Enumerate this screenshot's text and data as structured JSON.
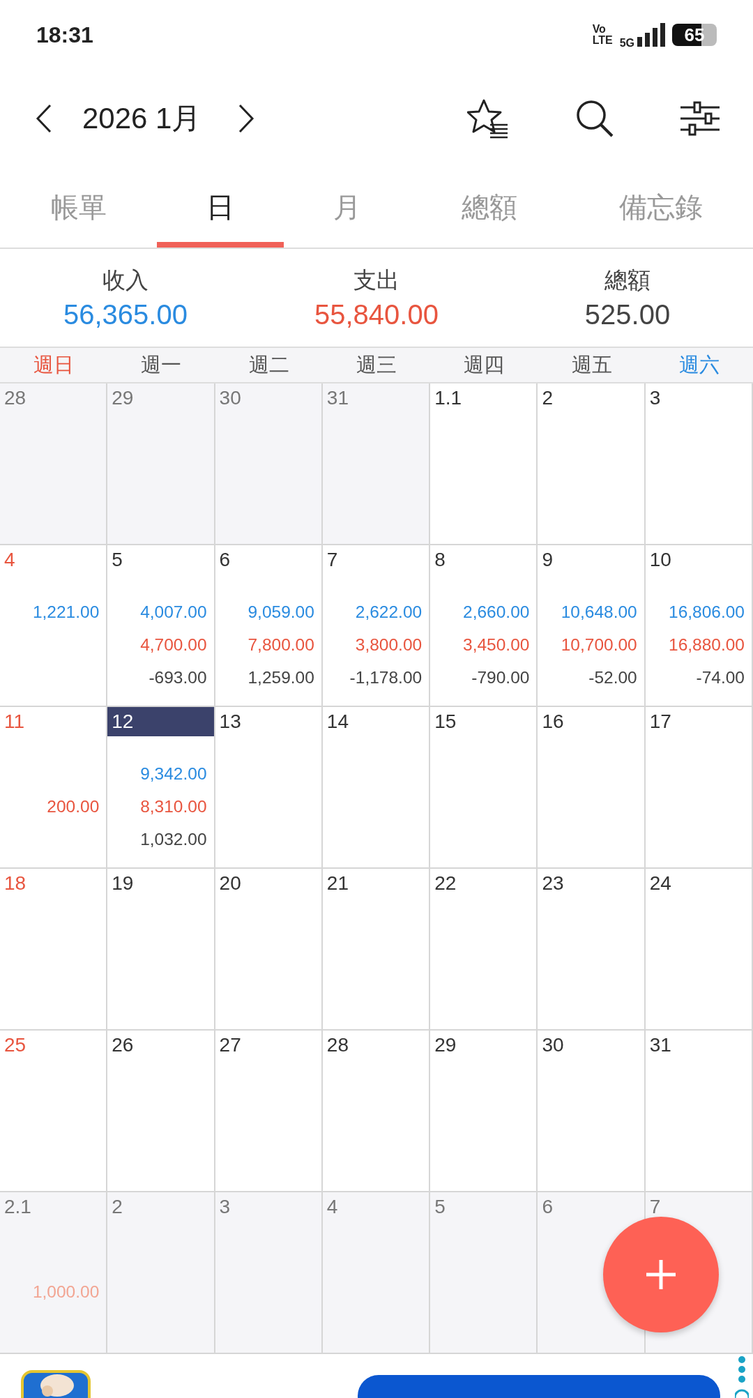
{
  "status_bar": {
    "time": "18:31",
    "network_top": "Vo",
    "network_bottom": "LTE",
    "signal_label": "5G",
    "battery": "65"
  },
  "header": {
    "title": "2026 1月"
  },
  "tabs": [
    {
      "label": "帳單",
      "selected": false
    },
    {
      "label": "日",
      "selected": true
    },
    {
      "label": "月",
      "selected": false
    },
    {
      "label": "總額",
      "selected": false
    },
    {
      "label": "備忘錄",
      "selected": false
    }
  ],
  "summary": [
    {
      "label": "收入",
      "value": "56,365.00",
      "kind": "income"
    },
    {
      "label": "支出",
      "value": "55,840.00",
      "kind": "expense"
    },
    {
      "label": "總額",
      "value": "525.00",
      "kind": "total"
    }
  ],
  "weekdays": [
    {
      "label": "週日",
      "color": "#e8553f"
    },
    {
      "label": "週一",
      "color": "#555555"
    },
    {
      "label": "週二",
      "color": "#555555"
    },
    {
      "label": "週三",
      "color": "#555555"
    },
    {
      "label": "週四",
      "color": "#555555"
    },
    {
      "label": "週五",
      "color": "#555555"
    },
    {
      "label": "週六",
      "color": "#2a8be0"
    }
  ],
  "weeks": [
    [
      {
        "day": "28",
        "other_month": true,
        "selected": false
      },
      {
        "day": "29",
        "other_month": true,
        "selected": false
      },
      {
        "day": "30",
        "other_month": true,
        "selected": false
      },
      {
        "day": "31",
        "other_month": true,
        "selected": false
      },
      {
        "day": "1.1",
        "other_month": false,
        "selected": false
      },
      {
        "day": "2",
        "other_month": false,
        "selected": false
      },
      {
        "day": "3",
        "other_month": false,
        "selected": false
      }
    ],
    [
      {
        "day": "4",
        "other_month": false,
        "selected": false,
        "income": "1,221.00"
      },
      {
        "day": "5",
        "other_month": false,
        "selected": false,
        "income": "4,007.00",
        "expense": "4,700.00",
        "total": "-693.00"
      },
      {
        "day": "6",
        "other_month": false,
        "selected": false,
        "income": "9,059.00",
        "expense": "7,800.00",
        "total": "1,259.00"
      },
      {
        "day": "7",
        "other_month": false,
        "selected": false,
        "income": "2,622.00",
        "expense": "3,800.00",
        "total": "-1,178.00"
      },
      {
        "day": "8",
        "other_month": false,
        "selected": false,
        "income": "2,660.00",
        "expense": "3,450.00",
        "total": "-790.00"
      },
      {
        "day": "9",
        "other_month": false,
        "selected": false,
        "income": "10,648.00",
        "expense": "10,700.00",
        "total": "-52.00"
      },
      {
        "day": "10",
        "other_month": false,
        "selected": false,
        "income": "16,806.00",
        "expense": "16,880.00",
        "total": "-74.00"
      }
    ],
    [
      {
        "day": "11",
        "other_month": false,
        "selected": false,
        "expense": "200.00"
      },
      {
        "day": "12",
        "other_month": false,
        "selected": true,
        "income": "9,342.00",
        "expense": "8,310.00",
        "total": "1,032.00"
      },
      {
        "day": "13",
        "other_month": false,
        "selected": false
      },
      {
        "day": "14",
        "other_month": false,
        "selected": false
      },
      {
        "day": "15",
        "other_month": false,
        "selected": false
      },
      {
        "day": "16",
        "other_month": false,
        "selected": false
      },
      {
        "day": "17",
        "other_month": false,
        "selected": false
      }
    ],
    [
      {
        "day": "18",
        "other_month": false,
        "selected": false
      },
      {
        "day": "19",
        "other_month": false,
        "selected": false
      },
      {
        "day": "20",
        "other_month": false,
        "selected": false
      },
      {
        "day": "21",
        "other_month": false,
        "selected": false
      },
      {
        "day": "22",
        "other_month": false,
        "selected": false
      },
      {
        "day": "23",
        "other_month": false,
        "selected": false
      },
      {
        "day": "24",
        "other_month": false,
        "selected": false
      }
    ],
    [
      {
        "day": "25",
        "other_month": false,
        "selected": false
      },
      {
        "day": "26",
        "other_month": false,
        "selected": false
      },
      {
        "day": "27",
        "other_month": false,
        "selected": false
      },
      {
        "day": "28",
        "other_month": false,
        "selected": false
      },
      {
        "day": "29",
        "other_month": false,
        "selected": false
      },
      {
        "day": "30",
        "other_month": false,
        "selected": false
      },
      {
        "day": "31",
        "other_month": false,
        "selected": false
      }
    ],
    [
      {
        "day": "2.1",
        "other_month": true,
        "selected": false,
        "expense": "1,000.00"
      },
      {
        "day": "2",
        "other_month": true,
        "selected": false
      },
      {
        "day": "3",
        "other_month": true,
        "selected": false
      },
      {
        "day": "4",
        "other_month": true,
        "selected": false
      },
      {
        "day": "5",
        "other_month": true,
        "selected": false
      },
      {
        "day": "6",
        "other_month": true,
        "selected": false
      },
      {
        "day": "7",
        "other_month": true,
        "selected": false
      }
    ]
  ]
}
